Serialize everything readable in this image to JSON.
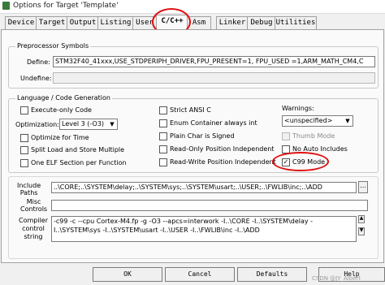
{
  "window": {
    "title": "Options for Target 'Template'"
  },
  "tabs": [
    "Device",
    "Target",
    "Output",
    "Listing",
    "User",
    "C/C++",
    "Asm",
    "Linker",
    "Debug",
    "Utilities"
  ],
  "active_tab": "C/C++",
  "preprocessor": {
    "title": "Preprocessor Symbols",
    "define_label": "Define:",
    "define_value": "STM32F40_41xxx,USE_STDPERIPH_DRIVER,FPU_PRESENT=1, FPU_USED =1,ARM_MATH_CM4,C",
    "undefine_label": "Undefine:",
    "undefine_value": ""
  },
  "codegen": {
    "title": "Language / Code Generation",
    "execute_only": "Execute-only Code",
    "optimization_label": "Optimization:",
    "optimization_value": "Level 3 (-O3)",
    "optimize_time": "Optimize for Time",
    "split_ls": "Split Load and Store Multiple",
    "one_elf": "One ELF Section per Function",
    "strict_ansi": "Strict ANSI C",
    "enum_int": "Enum Container always int",
    "plain_char": "Plain Char is Signed",
    "ropi": "Read-Only Position Independent",
    "rwpi": "Read-Write Position Independent",
    "warnings_label": "Warnings:",
    "warnings_value": "<unspecified>",
    "thumb_mode": "Thumb Mode",
    "no_auto_includes": "No Auto Includes",
    "c99_mode": "C99 Mode"
  },
  "paths": {
    "include_label": "Include\nPaths",
    "include_value": "..\\CORE;..\\SYSTEM\\delay;..\\SYSTEM\\sys;..\\SYSTEM\\usart;..\\USER;..\\FWLIB\\inc;..\\ADD",
    "misc_label": "Misc\nControls",
    "misc_value": "",
    "compiler_label": "Compiler\ncontrol\nstring",
    "compiler_value": "-c99 -c --cpu Cortex-M4.fp -g -O3 --apcs=interwork -I..\\CORE -I..\\SYSTEM\\delay -I..\\SYSTEM\\sys -I..\\SYSTEM\\usart -I..\\USER -I..\\FWLIB\\inc -I..\\ADD"
  },
  "buttons": {
    "ok": "OK",
    "cancel": "Cancel",
    "defaults": "Defaults",
    "help": "Help"
  },
  "browse_label": "...",
  "watermark": "CSDN @JY_Albert",
  "annotation_color": "#e01010"
}
